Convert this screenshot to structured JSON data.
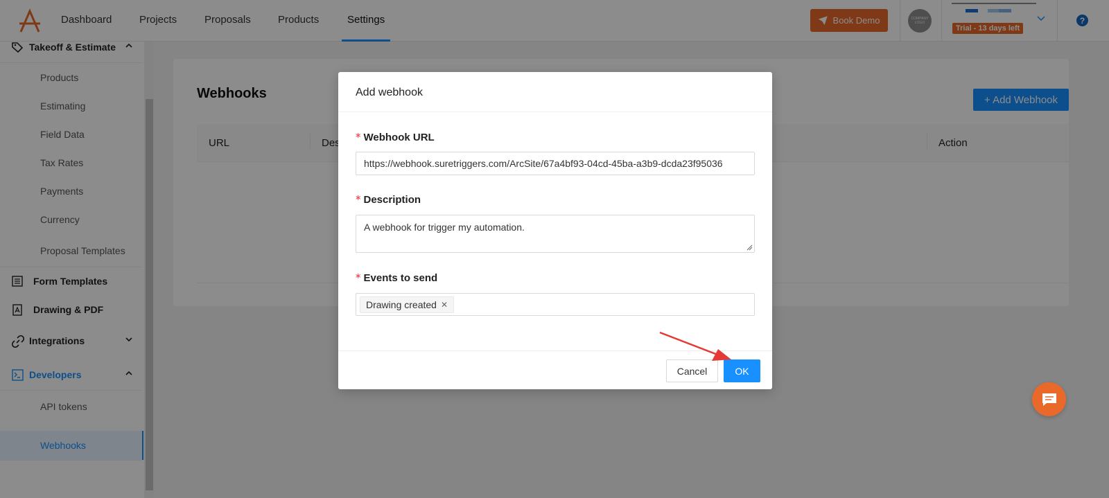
{
  "topnav": {
    "items": [
      "Dashboard",
      "Projects",
      "Proposals",
      "Products",
      "Settings"
    ],
    "active": "Settings",
    "book_demo_label": "Book Demo",
    "company_logo_text": "COMPANY LOGO",
    "trial_label": "Trial - 13 days left"
  },
  "sidebar": {
    "takeoff_label": "Takeoff & Estimate",
    "takeoff_subitems": [
      "Products",
      "Estimating",
      "Field Data",
      "Tax Rates",
      "Payments",
      "Currency",
      "Proposal Templates"
    ],
    "form_templates_label": "Form Templates",
    "drawing_pdf_label": "Drawing & PDF",
    "integrations_label": "Integrations",
    "developers_label": "Developers",
    "developers_subitems": [
      "API tokens",
      "Webhooks"
    ],
    "active_item": "Webhooks"
  },
  "main": {
    "title": "Webhooks",
    "add_button_label": "+ Add Webhook",
    "table_headers": [
      "URL",
      "Des",
      "Action"
    ]
  },
  "modal": {
    "title": "Add webhook",
    "url_label": "Webhook URL",
    "url_value": "https://webhook.suretriggers.com/ArcSite/67a4bf93-04cd-45ba-a3b9-dcda23f95036",
    "description_label": "Description",
    "description_value": "A webhook for trigger my automation.",
    "events_label": "Events to send",
    "events_selected": [
      "Drawing created"
    ],
    "cancel_label": "Cancel",
    "ok_label": "OK"
  },
  "colors": {
    "brand_orange": "#e8692a",
    "primary_blue": "#1890ff",
    "annotation_red": "#e53935"
  }
}
